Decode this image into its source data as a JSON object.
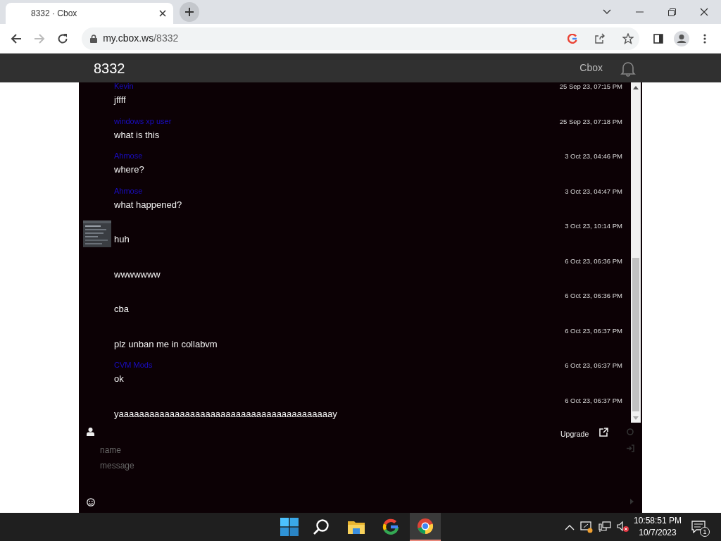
{
  "browser": {
    "tab_title": "8332 · Cbox",
    "url_host": "my.cbox.ws",
    "url_path": "/8332",
    "forward_disabled": true
  },
  "header": {
    "title": "8332",
    "link": "Cbox"
  },
  "messages": [
    {
      "name": "Kevin",
      "text": "jffff",
      "time": "25 Sep 23, 07:15 PM",
      "avatar": false
    },
    {
      "name": "windows xp user",
      "text": "what is this",
      "time": "25 Sep 23, 07:18 PM",
      "avatar": false
    },
    {
      "name": "Ahmose",
      "text": "where?",
      "time": "3 Oct 23, 04:46 PM",
      "avatar": false
    },
    {
      "name": "Ahmose",
      "text": "what happened?",
      "time": "3 Oct 23, 04:47 PM",
      "avatar": false
    },
    {
      "text": "huh",
      "time": "3 Oct 23, 10:14 PM",
      "avatar": true
    },
    {
      "text": "wwwwwww",
      "time": "6 Oct 23, 06:36 PM",
      "avatar": false
    },
    {
      "text": "cba",
      "time": "6 Oct 23, 06:36 PM",
      "avatar": false
    },
    {
      "text": "plz unban me in collabvm",
      "time": "6 Oct 23, 06:37 PM",
      "avatar": false
    },
    {
      "name": "CVM Mods",
      "text": "ok",
      "time": "6 Oct 23, 06:37 PM",
      "avatar": false
    },
    {
      "text": "yaaaaaaaaaaaaaaaaaaaaaaaaaaaaaaaaaaaaaaaaaay",
      "time": "6 Oct 23, 06:37 PM",
      "avatar": false
    }
  ],
  "form": {
    "upgrade": "Upgrade",
    "name_placeholder": "name",
    "message_placeholder": "message"
  },
  "taskbar": {
    "apps": [
      {
        "kind": "start",
        "selected": false
      },
      {
        "kind": "search",
        "selected": false
      },
      {
        "kind": "files",
        "selected": false
      },
      {
        "kind": "google",
        "selected": false
      },
      {
        "kind": "chrome",
        "selected": true
      }
    ],
    "time": "10:58:51 PM",
    "date": "10/7/2023",
    "notification_count": "1"
  }
}
